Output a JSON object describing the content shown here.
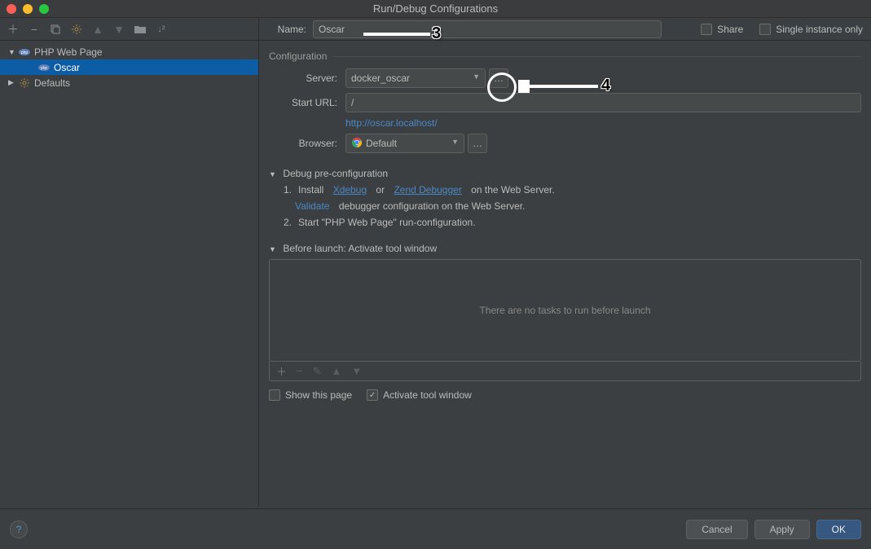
{
  "window": {
    "title": "Run/Debug Configurations"
  },
  "sidebar": {
    "items": [
      {
        "label": "PHP Web Page",
        "expanded": true
      },
      {
        "label": "Oscar",
        "selected": true
      },
      {
        "label": "Defaults",
        "expanded": false
      }
    ]
  },
  "header": {
    "name_label": "Name:",
    "name_value": "Oscar",
    "share_label": "Share",
    "single_instance_label": "Single instance only"
  },
  "config": {
    "section_title": "Configuration",
    "server_label": "Server:",
    "server_value": "docker_oscar",
    "start_url_label": "Start URL:",
    "start_url_value": "/",
    "resolved_url": "http://oscar.localhost/",
    "browser_label": "Browser:",
    "browser_value": "Default"
  },
  "debug": {
    "title": "Debug pre-configuration",
    "step1_prefix": "Install",
    "step1_link1": "Xdebug",
    "step1_or": "or",
    "step1_link2": "Zend Debugger",
    "step1_suffix": "on the Web Server.",
    "step1a_link": "Validate",
    "step1a_suffix": "debugger configuration on the Web Server.",
    "step2": "Start \"PHP Web Page\" run-configuration."
  },
  "before": {
    "title": "Before launch: Activate tool window",
    "empty": "There are no tasks to run before launch",
    "show_page_label": "Show this page",
    "activate_label": "Activate tool window"
  },
  "footer": {
    "cancel": "Cancel",
    "apply": "Apply",
    "ok": "OK"
  },
  "annotations": {
    "n3": "3",
    "n4": "4"
  }
}
